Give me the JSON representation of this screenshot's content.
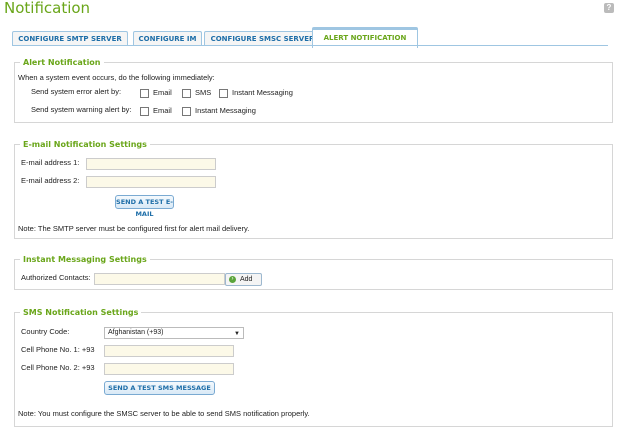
{
  "page": {
    "title": "Notification",
    "help": "?"
  },
  "tabs": [
    {
      "label": "CONFIGURE SMTP SERVER"
    },
    {
      "label": "CONFIGURE IM"
    },
    {
      "label": "CONFIGURE SMSC SERVER"
    },
    {
      "label": "ALERT NOTIFICATION",
      "active": true
    }
  ],
  "alert": {
    "legend": "Alert Notification",
    "intro": "When a system event occurs, do the following immediately:",
    "error_label": "Send system error alert by:",
    "warning_label": "Send system warning alert by:",
    "opt_email": "Email",
    "opt_sms": "SMS",
    "opt_im": "Instant Messaging"
  },
  "email": {
    "legend": "E-mail Notification Settings",
    "addr1_label": "E-mail address 1:",
    "addr2_label": "E-mail address 2:",
    "addr1_value": "",
    "addr2_value": "",
    "test_button": "SEND A TEST E-MAIL",
    "note": "Note: The SMTP server must be configured first for alert mail delivery."
  },
  "im": {
    "legend": "Instant Messaging Settings",
    "contacts_label": "Authorized Contacts:",
    "add_button": "Add"
  },
  "sms": {
    "legend": "SMS Notification Settings",
    "country_label": "Country Code:",
    "country_value": "Afghanistan (+93)",
    "phone1_label": "Cell Phone No. 1: +93",
    "phone2_label": "Cell Phone No. 2: +93",
    "test_button": "SEND A TEST SMS MESSAGE",
    "note": "Note: You must configure the SMSC server to be able to send SMS notification properly."
  },
  "colors": {
    "accent": "#6aa61a",
    "tab_text": "#1e6ea8",
    "input_bg": "#fcf9e8"
  }
}
